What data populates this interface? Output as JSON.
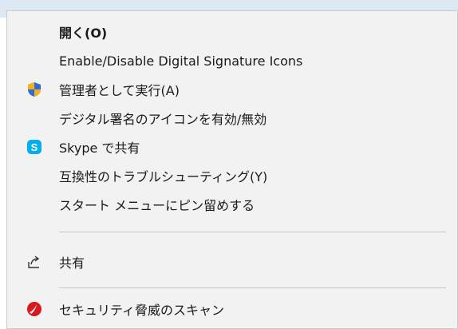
{
  "menu": {
    "items": [
      {
        "label": "開く(O)",
        "bold": true,
        "icon": ""
      },
      {
        "label": "Enable/Disable Digital Signature Icons",
        "icon": ""
      },
      {
        "label": "管理者として実行(A)",
        "icon": "uac-shield-icon"
      },
      {
        "label": "デジタル署名のアイコンを有効/無効",
        "icon": ""
      },
      {
        "label": "Skype で共有",
        "icon": "skype-icon"
      },
      {
        "label": "互換性のトラブルシューティング(Y)",
        "icon": ""
      },
      {
        "label": "スタート メニューにピン留めする",
        "icon": ""
      },
      {
        "label": "共有",
        "icon": "share-icon"
      },
      {
        "label": "セキュリティ脅威のスキャン",
        "icon": "trend-micro-icon"
      }
    ]
  },
  "colors": {
    "menu_bg": "#f2f2f2",
    "separator": "#c6c6c6",
    "skype_blue": "#00aff0",
    "shield_blue": "#2f6bd6",
    "shield_yellow": "#f3b21a",
    "trend_red": "#d71920"
  }
}
